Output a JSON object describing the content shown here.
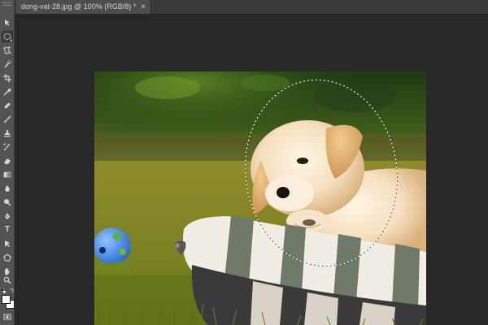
{
  "document": {
    "tab_title": "dong-vat-28.jpg @ 100% (RGB/8) *",
    "close_glyph": "×"
  },
  "tools": [
    {
      "name": "move-tool",
      "icon": "move-icon"
    },
    {
      "name": "elliptical-marquee-tool",
      "icon": "ellipse-marquee-icon",
      "active": true
    },
    {
      "name": "lasso-tool",
      "icon": "lasso-icon"
    },
    {
      "name": "quick-selection-tool",
      "icon": "quick-selection-icon"
    },
    {
      "name": "crop-tool",
      "icon": "crop-icon"
    },
    {
      "name": "eyedropper-tool",
      "icon": "eyedropper-icon"
    },
    {
      "name": "spot-healing-tool",
      "icon": "bandage-icon"
    },
    {
      "name": "brush-tool",
      "icon": "brush-icon"
    },
    {
      "name": "clone-stamp-tool",
      "icon": "stamp-icon"
    },
    {
      "name": "history-brush-tool",
      "icon": "history-brush-icon"
    },
    {
      "name": "eraser-tool",
      "icon": "eraser-icon"
    },
    {
      "name": "gradient-tool",
      "icon": "gradient-icon"
    },
    {
      "name": "blur-tool",
      "icon": "drop-icon"
    },
    {
      "name": "dodge-tool",
      "icon": "dodge-icon"
    },
    {
      "name": "pen-tool",
      "icon": "pen-icon"
    },
    {
      "name": "type-tool",
      "icon": "type-icon",
      "glyph": "T"
    },
    {
      "name": "path-selection-tool",
      "icon": "path-selection-icon"
    },
    {
      "name": "shape-tool",
      "icon": "shape-icon"
    },
    {
      "name": "hand-tool",
      "icon": "hand-icon"
    },
    {
      "name": "zoom-tool",
      "icon": "zoom-icon"
    }
  ],
  "colors": {
    "foreground": "#ffffff",
    "background": "#ffffff",
    "app_bg": "#282828",
    "panel_bg": "#535353"
  },
  "selection": {
    "shape": "ellipse",
    "style": "marching-ants"
  }
}
